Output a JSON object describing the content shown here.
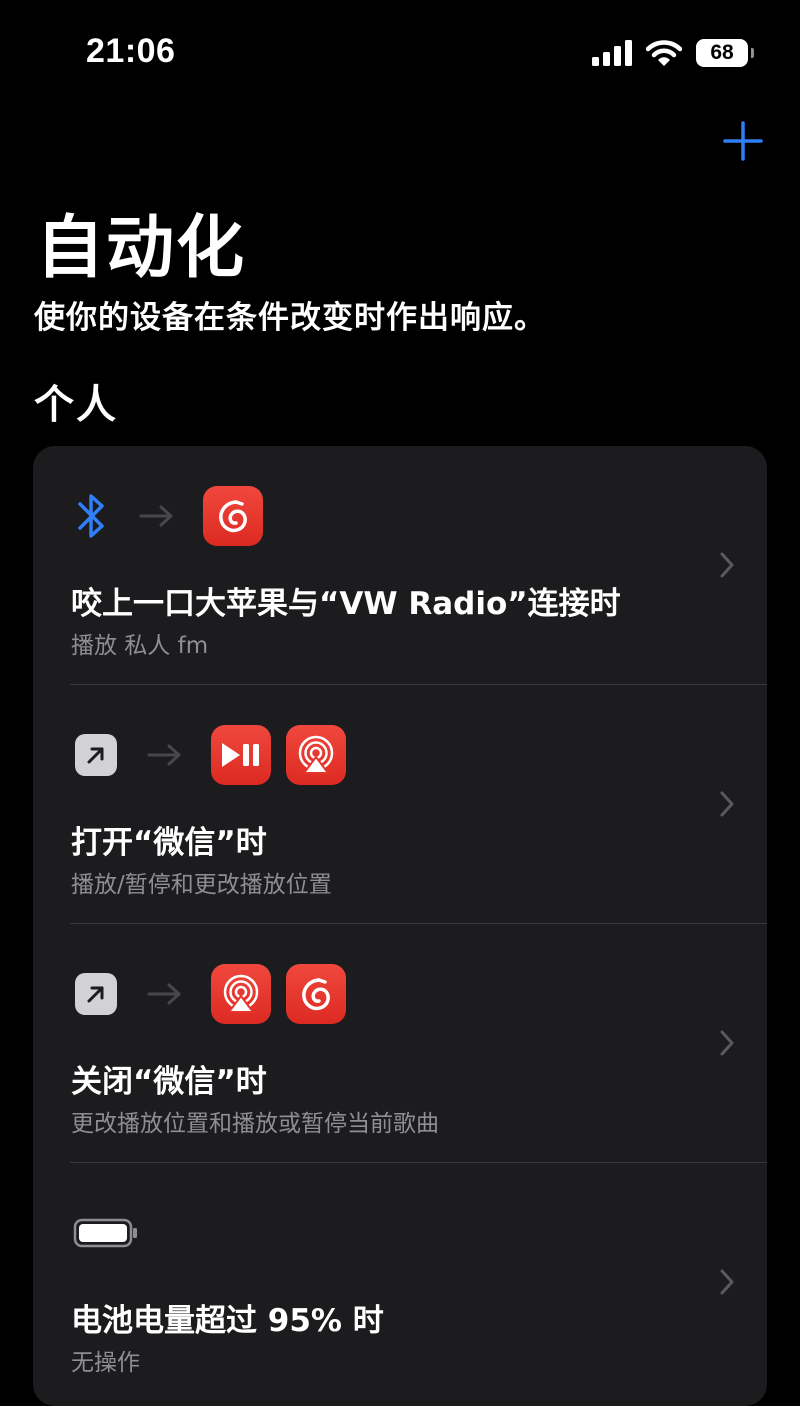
{
  "status_bar": {
    "time": "21:06",
    "battery": "68"
  },
  "header": {
    "title": "自动化",
    "subtitle": "使你的设备在条件改变时作出响应。"
  },
  "section": {
    "label": "个人"
  },
  "automations": [
    {
      "title": "咬上一口大苹果与“VW Radio”连接时",
      "subtitle": "播放 私人 fm"
    },
    {
      "title": "打开“微信”时",
      "subtitle": "播放/暂停和更改播放位置"
    },
    {
      "title": "关闭“微信”时",
      "subtitle": "更改播放位置和播放或暂停当前歌曲"
    },
    {
      "title": "电池电量超过 95% 时",
      "subtitle": "无操作"
    }
  ],
  "colors": {
    "accent": "#2f7ff7",
    "card": "#1c1c1e",
    "app_red": "#e8352c",
    "secondary_text": "#8e8e93"
  },
  "icons": [
    "bluetooth-icon",
    "netease-music-icon",
    "play-pause-icon",
    "airplay-icon",
    "open-app-icon",
    "battery-icon",
    "chevron-right-icon",
    "plus-icon"
  ]
}
